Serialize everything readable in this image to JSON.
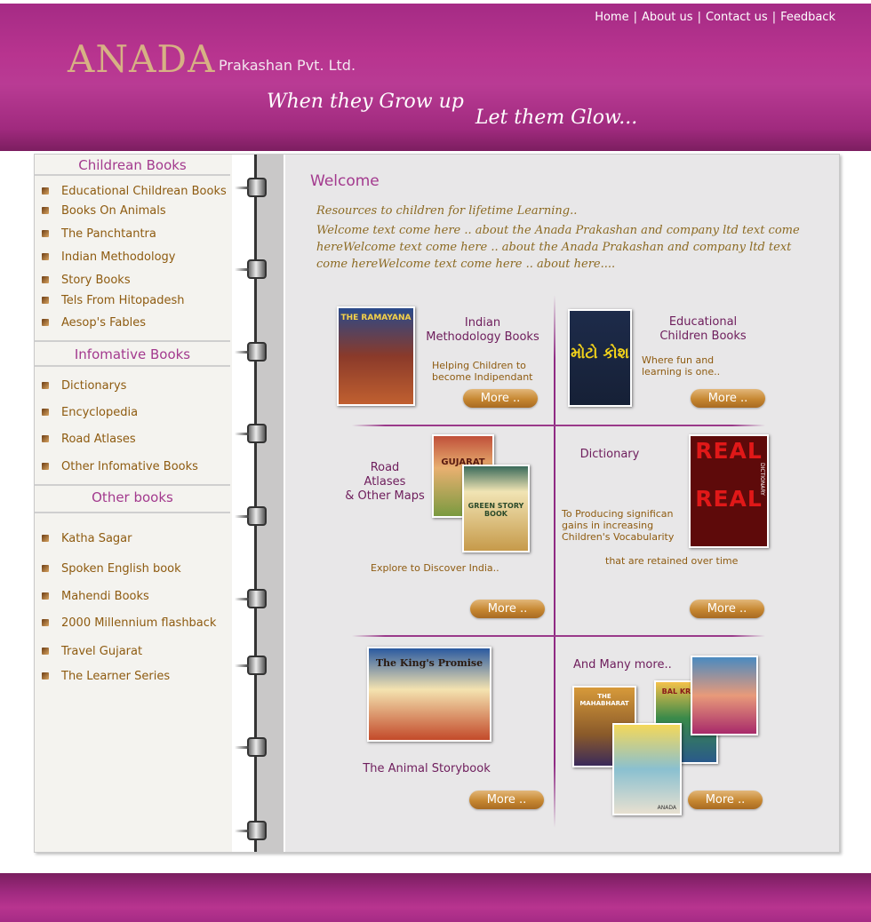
{
  "header": {
    "logo_main": "ANADA",
    "logo_sub": "Prakashan Pvt. Ltd.",
    "tagline_part1": "When they Grow up",
    "tagline_part2": "Let them Glow...",
    "nav": [
      "Home",
      "About us",
      "Contact us",
      "Feedback"
    ],
    "nav_separator": "|"
  },
  "sidebar": {
    "sections": [
      {
        "title": "Childrean Books",
        "items": [
          "Educational Childrean Books",
          "Books On Animals",
          "The Panchtantra",
          "Indian Methodology",
          "Story Books",
          "Tels From Hitopadesh",
          "Aesop's Fables"
        ]
      },
      {
        "title": "Infomative Books",
        "items": [
          "Dictionarys",
          "Encyclopedia",
          "Road Atlases",
          "Other Infomative Books"
        ]
      },
      {
        "title": "Other books",
        "items": [
          "Katha Sagar",
          "Spoken English book",
          "Mahendi Books",
          "2000 Millennium flashback",
          "Travel Gujarat",
          "The Learner Series"
        ]
      }
    ]
  },
  "main": {
    "welcome_title": "Welcome",
    "intro_line1": "Resources to children for lifetime Learning..",
    "intro_body": "Welcome text come here .. about the Anada Prakashan  and company ltd text come hereWelcome text come here .. about the Anada Prakashan  and company ltd text come hereWelcome text come here .. about here....",
    "more_label": "More ..",
    "products": [
      {
        "title": "Indian\nMethodology Books",
        "desc": "Helping Children to\nbecome Indipendant",
        "cover_text": "THE RAMAYANA"
      },
      {
        "title": "Educational\nChildren Books",
        "desc": "Where fun and\nlearning is one..",
        "cover_text": "મોટો કોશ"
      },
      {
        "title": "Road\nAtlases\n& Other Maps",
        "desc": "Explore to Discover India..",
        "cover_text": "GUJARAT",
        "cover_text_2": "GREEN STORY BOOK"
      },
      {
        "title": "Dictionary",
        "desc": "To Producing significan\ngains in increasing\nChildren's Vocabularity",
        "desc2": "that are retained over time",
        "cover_text": "REAL",
        "cover_spine": "DICTIONARY"
      },
      {
        "title": "The Animal Storybook",
        "desc": "",
        "cover_text": "The King's Promise"
      },
      {
        "title": "And Many more..",
        "desc": "",
        "cover_text": "THE MAHABHARAT",
        "cover_text_2": "BAL KRISHN",
        "cover_text_3": "ANADA"
      }
    ]
  },
  "colors": {
    "brand_magenta": "#b8348f",
    "heading_purple": "#a33a8e",
    "link_brown": "#8e5b10",
    "button_orange": "#c68731"
  }
}
